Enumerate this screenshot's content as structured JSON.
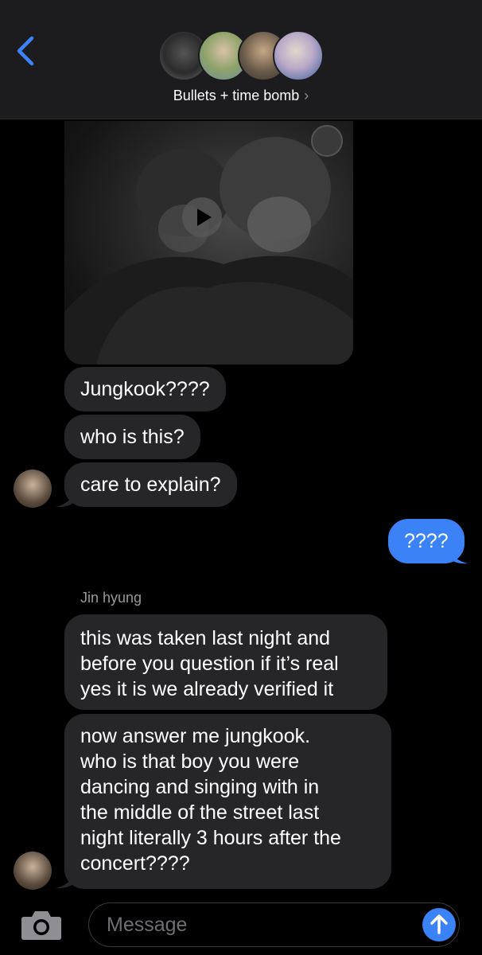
{
  "header": {
    "group_name": "Bullets + time bomb",
    "chevron": "›",
    "back_icon": "chevron-left-icon",
    "accent": "#3b82f6"
  },
  "messages": {
    "incoming_1": "Jungkook????",
    "incoming_2": "who is this?",
    "incoming_3": "care to explain?",
    "outgoing_1": "????",
    "sender_label": "Jin hyung",
    "incoming_4_lines": [
      "this was taken last night and",
      "before you question if it’s real",
      "yes it is we already verified it"
    ],
    "incoming_5_lines": [
      "now answer me jungkook.",
      "who is that boy you were",
      "dancing and singing with in",
      "the middle of the street last",
      "night literally 3 hours after the",
      "concert????"
    ]
  },
  "composer": {
    "placeholder": "Message",
    "camera_icon": "camera-icon",
    "send_icon": "arrow-up-icon"
  },
  "colors": {
    "incoming_bubble": "#262628",
    "outgoing_bubble": "#3b82f6",
    "header_bg": "#1c1c1e"
  }
}
